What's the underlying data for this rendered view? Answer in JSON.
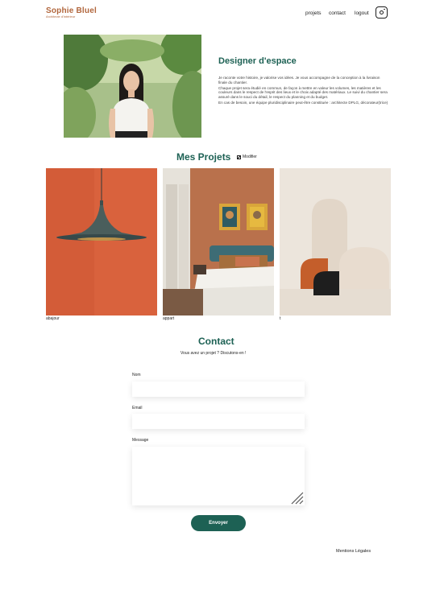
{
  "header": {
    "logo_name": "Sophie Bluel",
    "logo_subtitle": "Architecte d'intérieur",
    "nav": {
      "projets": "projets",
      "contact": "contact",
      "logout": "logout"
    },
    "instagram_icon": "instagram-icon"
  },
  "intro": {
    "title": "Designer d'espace",
    "paragraphs": [
      "Je raconte votre histoire, je valorise vos idées. Je vous accompagne de la conception à la livraison finale du chantier.",
      "Chaque projet sera étudié en commun, de façon à mettre en valeur les volumes, les matières et les couleurs dans le respect de l'esprit des lieux et le choix adapté des matériaux. Le suivi du chantier sera assuré dans le souci du détail, le respect du planning et du budget.",
      "En cas de besoin, une équipe pluridisciplinaire peut-être constituée : architecte DPLG, décorateur(trice)"
    ]
  },
  "projects": {
    "title": "Mes Projets",
    "edit_label": "Modifier",
    "edit_icon": "edit-icon",
    "items": [
      {
        "caption": "abajour"
      },
      {
        "caption": "appart"
      },
      {
        "caption": "t"
      }
    ]
  },
  "contact": {
    "title": "Contact",
    "subtitle": "Vous avez un projet ? Discutons-en !",
    "name_label": "Nom",
    "email_label": "Email",
    "message_label": "Message",
    "submit_label": "Envoyer"
  },
  "footer": {
    "legal": "Mentions Légales"
  },
  "colors": {
    "accent": "#1d6154",
    "brand": "#b1663c"
  }
}
